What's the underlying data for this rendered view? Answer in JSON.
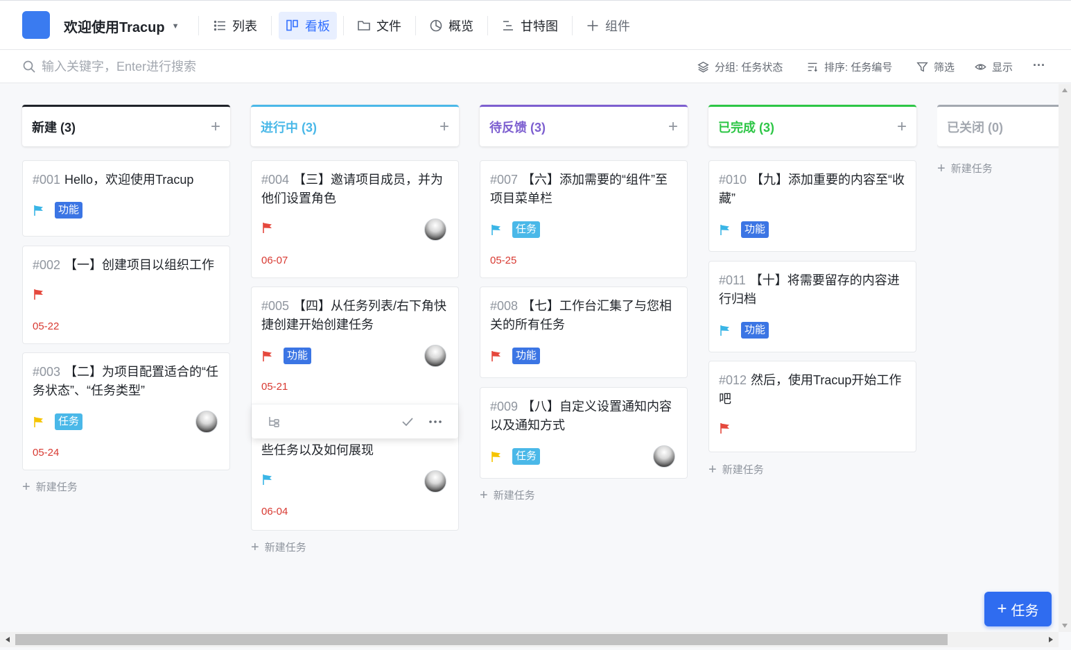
{
  "header": {
    "project_name": "欢迎使用Tracup",
    "tabs": [
      {
        "label": "列表",
        "icon": "list-icon"
      },
      {
        "label": "看板",
        "icon": "board-icon"
      },
      {
        "label": "文件",
        "icon": "folder-icon"
      },
      {
        "label": "概览",
        "icon": "pie-icon"
      },
      {
        "label": "甘特图",
        "icon": "gantt-icon"
      },
      {
        "label": "组件",
        "icon": "plus-icon"
      }
    ],
    "active_tab": "看板"
  },
  "toolbar": {
    "search_placeholder": "输入关键字，Enter进行搜索",
    "group_label": "分组: 任务状态",
    "sort_label": "排序: 任务编号",
    "filter_label": "筛选",
    "display_label": "显示",
    "more_label": "···"
  },
  "colors": {
    "accent": "#3370ff",
    "flag_red": "#e5483d",
    "flag_blue": "#3ab5e6",
    "flag_yellow": "#f5c400",
    "tag_feature": "#3b75e4",
    "tag_task": "#4ab8e8",
    "due_red": "#d83931"
  },
  "columns": [
    {
      "title": "新建 (3)",
      "color": "#1f2329",
      "new_task": "新建任务"
    },
    {
      "title": "进行中 (3)",
      "color": "#4ab8e8",
      "new_task": "新建任务"
    },
    {
      "title": "待反馈 (3)",
      "color": "#7d5fd0",
      "new_task": "新建任务"
    },
    {
      "title": "已完成 (3)",
      "color": "#2dc646",
      "new_task": "新建任务"
    },
    {
      "title": "已关闭 (0)",
      "color": "#a3a8b0",
      "new_task": "新建任务"
    }
  ],
  "cards": [
    {
      "num": "#001",
      "title": "Hello，欢迎使用Tracup",
      "flag": "blue",
      "tag": "功能",
      "tag_type": "feature",
      "avatar": false,
      "due": ""
    },
    {
      "num": "#002",
      "title": "【一】创建项目以组织工作",
      "flag": "red",
      "tag": "",
      "tag_type": "",
      "avatar": false,
      "due": "05-22"
    },
    {
      "num": "#003",
      "title": "【二】为项目配置适合的“任务状态”、“任务类型”",
      "flag": "yellow",
      "tag": "任务",
      "tag_type": "task",
      "avatar": true,
      "due": "05-24"
    },
    {
      "num": "#004",
      "title": "【三】邀请项目成员，并为他们设置角色",
      "flag": "red",
      "tag": "",
      "tag_type": "",
      "avatar": true,
      "due": "06-07"
    },
    {
      "num": "#005",
      "title": "【四】从任务列表/右下角快捷创建开始创建任务",
      "flag": "red",
      "tag": "功能",
      "tag_type": "feature",
      "avatar": true,
      "due": "05-21"
    },
    {
      "num": "",
      "title": "些任务以及如何展现",
      "flag": "blue",
      "tag": "",
      "tag_type": "",
      "avatar": true,
      "due": "06-04"
    },
    {
      "num": "#007",
      "title": "【六】添加需要的“组件”至项目菜单栏",
      "flag": "blue",
      "tag": "任务",
      "tag_type": "task",
      "avatar": false,
      "due": "05-25"
    },
    {
      "num": "#008",
      "title": "【七】工作台汇集了与您相关的所有任务",
      "flag": "red",
      "tag": "功能",
      "tag_type": "feature",
      "avatar": false,
      "due": ""
    },
    {
      "num": "#009",
      "title": "【八】自定义设置通知内容以及通知方式",
      "flag": "yellow",
      "tag": "任务",
      "tag_type": "task",
      "avatar": true,
      "due": ""
    },
    {
      "num": "#010",
      "title": "【九】添加重要的内容至“收藏”",
      "flag": "blue",
      "tag": "功能",
      "tag_type": "feature",
      "avatar": false,
      "due": ""
    },
    {
      "num": "#011",
      "title": "【十】将需要留存的内容进行归档",
      "flag": "blue",
      "tag": "功能",
      "tag_type": "feature",
      "avatar": false,
      "due": ""
    },
    {
      "num": "#012",
      "title": "然后，使用Tracup开始工作吧",
      "flag": "red",
      "tag": "",
      "tag_type": "",
      "avatar": false,
      "due": ""
    }
  ],
  "fab": {
    "label": "任务"
  }
}
